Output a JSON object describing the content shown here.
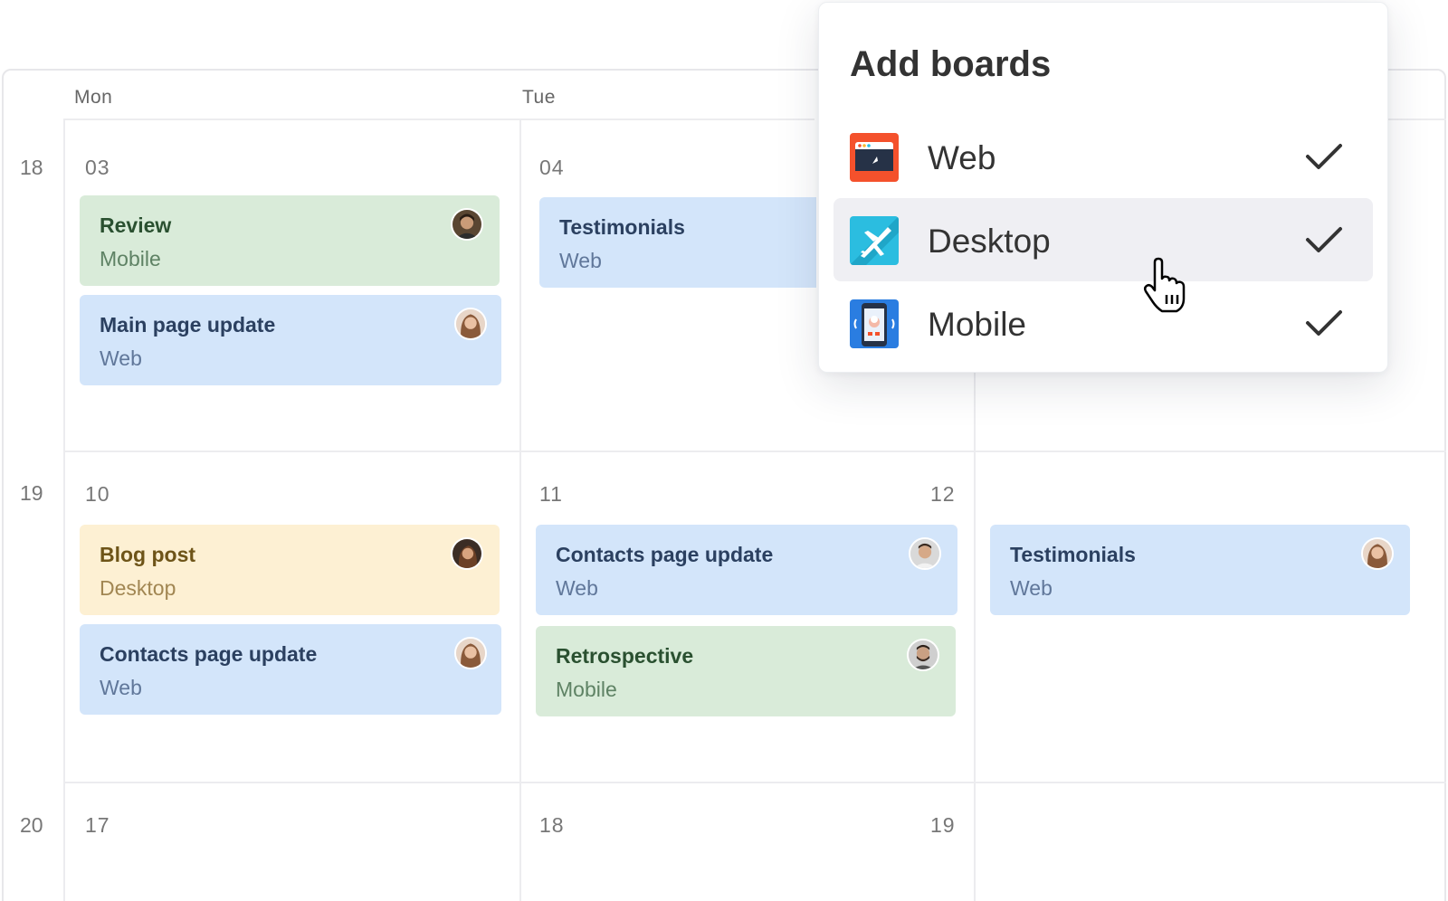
{
  "calendar": {
    "day_headers": [
      "Mon",
      "Tue"
    ],
    "week_numbers": [
      "18",
      "19",
      "20"
    ],
    "dates": {
      "w1": [
        "03",
        "04"
      ],
      "w2": [
        "10",
        "11",
        "12"
      ],
      "w3": [
        "17",
        "18",
        "19"
      ]
    }
  },
  "events": [
    {
      "title": "Review",
      "board": "Mobile"
    },
    {
      "title": "Main page update",
      "board": "Web"
    },
    {
      "title": "Testimonials",
      "board": "Web"
    },
    {
      "title": "Blog post",
      "board": "Desktop"
    },
    {
      "title": "Contacts page update",
      "board": "Web"
    },
    {
      "title": "Contacts page update",
      "board": "Web"
    },
    {
      "title": "Retrospective",
      "board": "Mobile"
    },
    {
      "title": "Testimonials",
      "board": "Web"
    }
  ],
  "add_boards": {
    "title": "Add boards",
    "boards": [
      {
        "label": "Web",
        "checked": true,
        "icon": "web-board-icon"
      },
      {
        "label": "Desktop",
        "checked": true,
        "icon": "desktop-board-icon"
      },
      {
        "label": "Mobile",
        "checked": true,
        "icon": "mobile-board-icon"
      }
    ],
    "hovered": "Desktop"
  },
  "colors": {
    "web_event": "#d3e5fa",
    "mobile_event": "#d9ebd9",
    "desktop_event": "#fdf0d3",
    "web_board": "#f4512c",
    "desktop_board": "#2bbde0",
    "mobile_board": "#2a7de1"
  }
}
